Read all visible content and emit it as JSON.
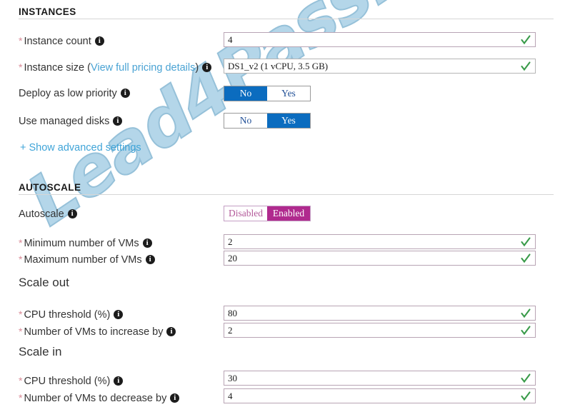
{
  "sections": {
    "instances": {
      "header": "INSTANCES",
      "rows": [
        {
          "label": "Instance count",
          "required": true,
          "control": "text",
          "value": "4",
          "valid": true
        },
        {
          "label_prefix": "Instance size (",
          "label_link": "View full pricing details",
          "label_suffix": ")",
          "required": true,
          "control": "text",
          "value": "DS1_v2 (1 vCPU, 3.5 GB)",
          "valid": true
        },
        {
          "label": "Deploy as low priority",
          "required": false,
          "control": "toggle",
          "options": [
            "No",
            "Yes"
          ],
          "selected": "No"
        },
        {
          "label": "Use managed disks",
          "required": false,
          "control": "toggle",
          "options": [
            "No",
            "Yes"
          ],
          "selected": "Yes"
        }
      ],
      "advanced_link": "+ Show advanced settings"
    },
    "autoscale": {
      "header": "AUTOSCALE",
      "toggle_row": {
        "label": "Autoscale",
        "options": [
          "Disabled",
          "Enabled"
        ],
        "selected": "Enabled"
      },
      "min_vms": {
        "label": "Minimum number of VMs",
        "value": "2",
        "valid": true
      },
      "max_vms": {
        "label": "Maximum number of VMs",
        "value": "20",
        "valid": true
      },
      "scale_out": {
        "heading": "Scale out",
        "cpu_threshold": {
          "label": "CPU threshold (%)",
          "value": "80",
          "valid": true
        },
        "vm_delta": {
          "label": "Number of VMs to increase by",
          "value": "2",
          "valid": true
        }
      },
      "scale_in": {
        "heading": "Scale in",
        "cpu_threshold": {
          "label": "CPU threshold (%)",
          "value": "30",
          "valid": true
        },
        "vm_delta": {
          "label": "Number of VMs to decrease by",
          "value": "4",
          "valid": true
        }
      }
    }
  },
  "watermark": {
    "text": "Lead4Pass.com"
  },
  "colors": {
    "toggle_selected_blue": "#0b6cbf",
    "toggle_selected_magenta": "#b02a8e",
    "link_blue": "#3fa4d8",
    "valid_check_green": "#3a9b4a",
    "required_asterisk": "#d98a96",
    "field_border_mauve": "#b8a4b4",
    "watermark_blue": "#aed3e8"
  },
  "icons": {
    "info": "info-icon",
    "valid": "check-icon"
  }
}
